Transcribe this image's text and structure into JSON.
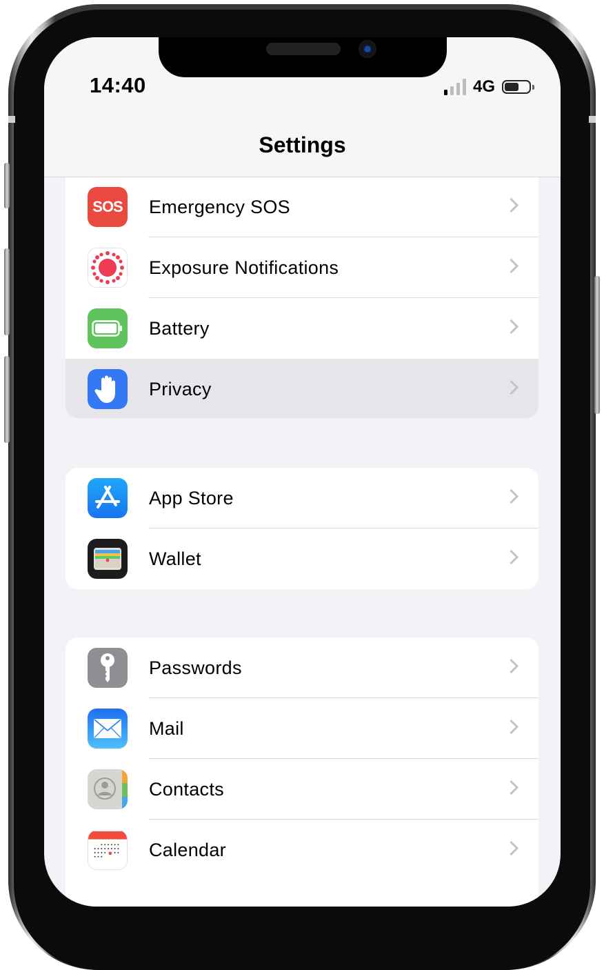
{
  "status_bar": {
    "time": "14:40",
    "network": "4G"
  },
  "nav": {
    "title": "Settings"
  },
  "icons": {
    "sos_text": "SOS"
  },
  "groups": [
    {
      "rows": [
        {
          "label": "Emergency SOS",
          "icon": "sos-icon",
          "icon_color": "#e9493f"
        },
        {
          "label": "Exposure Notifications",
          "icon": "exposure-notifications-icon",
          "icon_color": "#ffffff"
        },
        {
          "label": "Battery",
          "icon": "battery-icon",
          "icon_color": "#5ec45b"
        },
        {
          "label": "Privacy",
          "icon": "hand-icon",
          "icon_color": "#3478f6",
          "selected": true
        }
      ]
    },
    {
      "rows": [
        {
          "label": "App Store",
          "icon": "app-store-icon",
          "icon_color": "#1a8cf3"
        },
        {
          "label": "Wallet",
          "icon": "wallet-icon",
          "icon_color": "#1c1c1e"
        }
      ]
    },
    {
      "rows": [
        {
          "label": "Passwords",
          "icon": "key-icon",
          "icon_color": "#8e8e93"
        },
        {
          "label": "Mail",
          "icon": "mail-icon",
          "icon_color": "#2f8cf6"
        },
        {
          "label": "Contacts",
          "icon": "contacts-icon",
          "icon_color": "#d6d6d1"
        },
        {
          "label": "Calendar",
          "icon": "calendar-icon",
          "icon_color": "#ffffff"
        }
      ]
    }
  ],
  "colors": {
    "background": "#f2f2f7",
    "selected_row": "#e5e5ea",
    "chevron": "#c4c4c7"
  }
}
